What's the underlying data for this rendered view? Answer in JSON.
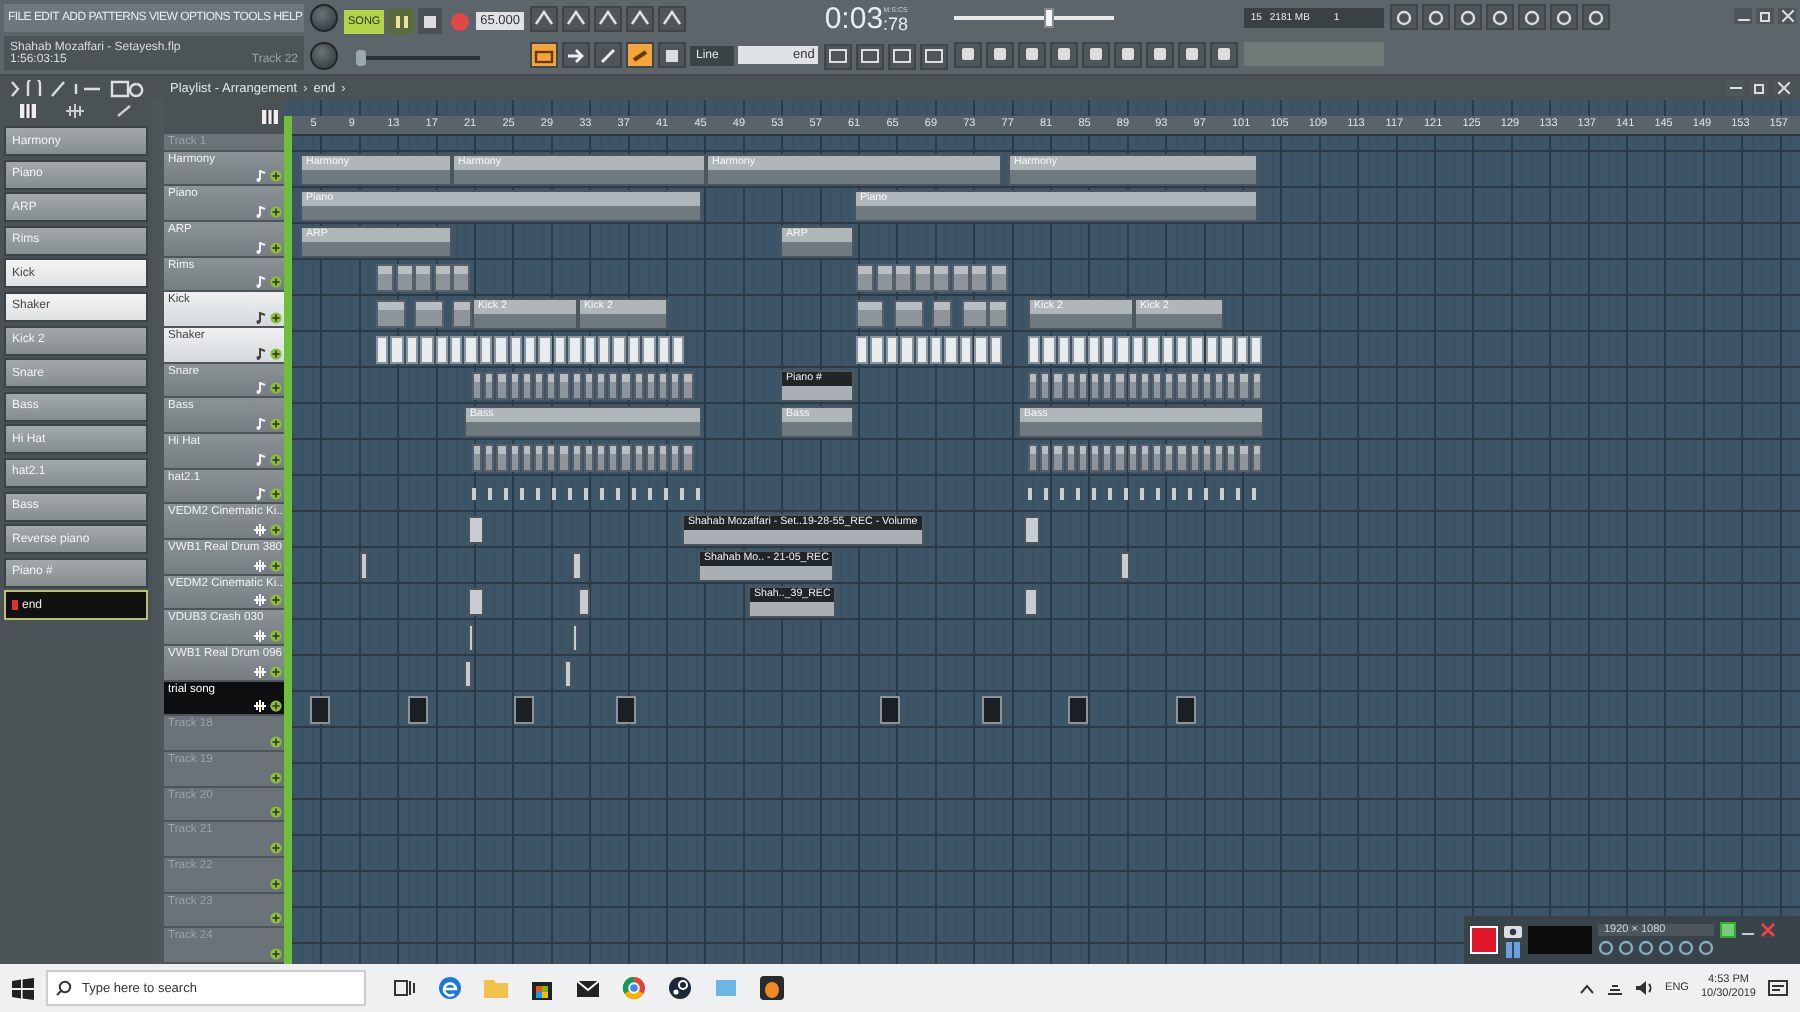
{
  "menu": [
    "FILE",
    "EDIT",
    "ADD",
    "PATTERNS",
    "VIEW",
    "OPTIONS",
    "TOOLS",
    "HELP"
  ],
  "song_info": {
    "title": "Shahab Mozaffari - Setayesh.flp",
    "position": "1:56:03:15",
    "track": "Track 22"
  },
  "transport": {
    "mode": "SONG",
    "song_selected": true,
    "playing": true,
    "tempo": "65.000"
  },
  "time": {
    "main": "0:03",
    "sub": ":78",
    "unit": "M:S:CS"
  },
  "master_volume": {
    "level": 0.62
  },
  "master_pitch": {
    "level": 0
  },
  "cpu": {
    "polyphony": "15",
    "memory": "2181 MB",
    "value": "1"
  },
  "snap": "Line",
  "pattern": "end",
  "playlist": {
    "title": "Playlist - Arrangement",
    "sep": "›",
    "pattern": "end",
    "sep2": "›"
  },
  "channels": [
    {
      "name": "Harmony",
      "selected": false,
      "current": false
    },
    {
      "name": "Piano",
      "selected": false,
      "current": false
    },
    {
      "name": "ARP",
      "selected": false,
      "current": false
    },
    {
      "name": "Rims",
      "selected": false,
      "current": false
    },
    {
      "name": "Kick",
      "selected": true,
      "current": false
    },
    {
      "name": "Shaker",
      "selected": true,
      "current": false
    },
    {
      "name": "Kick 2",
      "selected": false,
      "current": false
    },
    {
      "name": "Snare",
      "selected": false,
      "current": false
    },
    {
      "name": "Bass",
      "selected": false,
      "current": false
    },
    {
      "name": "Hi Hat",
      "selected": false,
      "current": false
    },
    {
      "name": "hat2.1",
      "selected": false,
      "current": false
    },
    {
      "name": "Bass",
      "selected": false,
      "current": false
    },
    {
      "name": "Reverse piano",
      "selected": false,
      "current": false
    },
    {
      "name": "Piano #",
      "selected": false,
      "current": false
    },
    {
      "name": "end",
      "selected": false,
      "current": true
    }
  ],
  "ruler": [
    "5",
    "9",
    "13",
    "17",
    "21",
    "25",
    "29",
    "33",
    "37",
    "41",
    "45",
    "49",
    "53",
    "57",
    "61",
    "65",
    "69",
    "73",
    "77",
    "81",
    "85",
    "89",
    "93",
    "97",
    "101",
    "105",
    "109",
    "113",
    "117",
    "121",
    "125",
    "129",
    "133",
    "137",
    "141",
    "145",
    "149",
    "153",
    "157"
  ],
  "tracks": [
    {
      "name": "Track 1",
      "kind": "empty",
      "selected": false,
      "highlighted": false
    },
    {
      "name": "Harmony",
      "kind": "instrument",
      "selected": false,
      "highlighted": false
    },
    {
      "name": "Piano",
      "kind": "instrument",
      "selected": false,
      "highlighted": false
    },
    {
      "name": "ARP",
      "kind": "instrument",
      "selected": false,
      "highlighted": false
    },
    {
      "name": "Rims",
      "kind": "instrument",
      "selected": false,
      "highlighted": false
    },
    {
      "name": "Kick",
      "kind": "instrument",
      "selected": false,
      "highlighted": true
    },
    {
      "name": "Shaker",
      "kind": "instrument",
      "selected": false,
      "highlighted": true
    },
    {
      "name": "Snare",
      "kind": "instrument",
      "selected": false,
      "highlighted": false
    },
    {
      "name": "Bass",
      "kind": "instrument",
      "selected": false,
      "highlighted": false
    },
    {
      "name": "Hi Hat",
      "kind": "instrument",
      "selected": false,
      "highlighted": false
    },
    {
      "name": "hat2.1",
      "kind": "instrument",
      "selected": false,
      "highlighted": false
    },
    {
      "name": "VEDM2 Cinematic Ki..",
      "kind": "audio",
      "selected": false,
      "highlighted": false
    },
    {
      "name": "VWB1 Real Drum 380",
      "kind": "audio",
      "selected": false,
      "highlighted": false
    },
    {
      "name": "VEDM2 Cinematic Ki..",
      "kind": "audio",
      "selected": false,
      "highlighted": false
    },
    {
      "name": "VDUB3 Crash 030",
      "kind": "audio",
      "selected": false,
      "highlighted": false
    },
    {
      "name": "VWB1 Real Drum 096",
      "kind": "audio",
      "selected": false,
      "highlighted": false
    },
    {
      "name": "trial song",
      "kind": "audio",
      "selected": true,
      "highlighted": false
    },
    {
      "name": "Track 18",
      "kind": "empty",
      "selected": false,
      "highlighted": false
    },
    {
      "name": "Track 19",
      "kind": "empty",
      "selected": false,
      "highlighted": false
    },
    {
      "name": "Track 20",
      "kind": "empty",
      "selected": false,
      "highlighted": false
    },
    {
      "name": "Track 21",
      "kind": "empty",
      "selected": false,
      "highlighted": false
    },
    {
      "name": "Track 22",
      "kind": "empty",
      "selected": false,
      "highlighted": false
    },
    {
      "name": "Track 23",
      "kind": "empty",
      "selected": false,
      "highlighted": false
    },
    {
      "name": "Track 24",
      "kind": "empty",
      "selected": false,
      "highlighted": false
    }
  ],
  "clips": [
    {
      "label": "Harmony",
      "kind": "pattern"
    },
    {
      "label": "Harmony",
      "kind": "pattern"
    },
    {
      "label": "Harmony",
      "kind": "pattern"
    },
    {
      "label": "Harmony",
      "kind": "pattern"
    },
    {
      "label": "Piano",
      "kind": "pattern"
    },
    {
      "label": "Piano",
      "kind": "pattern"
    },
    {
      "label": "ARP",
      "kind": "pattern"
    },
    {
      "label": "ARP",
      "kind": "pattern"
    },
    {
      "label": "Kick 2",
      "kind": "pattern"
    },
    {
      "label": "Kick 2",
      "kind": "pattern"
    },
    {
      "label": "Kick 2",
      "kind": "pattern"
    },
    {
      "label": "Kick 2",
      "kind": "pattern"
    },
    {
      "label": "Piano #",
      "kind": "automation"
    },
    {
      "label": "Bass",
      "kind": "pattern"
    },
    {
      "label": "Bass",
      "kind": "pattern"
    },
    {
      "label": "Bass",
      "kind": "pattern"
    },
    {
      "label": "Shahab Mozaffari - Set..19-28-55_REC - Volume",
      "kind": "automation"
    },
    {
      "label": "Shahab Mo.. - 21-05_REC",
      "kind": "automation"
    },
    {
      "label": "Shah.._39_REC",
      "kind": "automation"
    }
  ],
  "recorder": {
    "resolution": "1920 × 1080"
  },
  "taskbar": {
    "search_placeholder": "Type here to search",
    "language": "ENG",
    "clock": "4:53 PM",
    "date": "10/30/2019"
  }
}
